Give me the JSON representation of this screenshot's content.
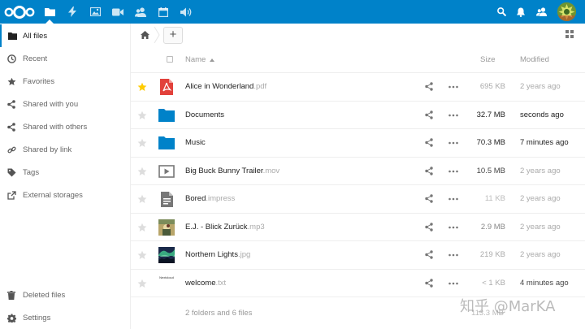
{
  "header": {
    "apps": [
      "Files",
      "Activity",
      "Gallery",
      "Talk",
      "Contacts",
      "Calendar",
      "Audio player"
    ],
    "icons": [
      "nextcloud-logo",
      "folder-icon",
      "bolt-icon",
      "image-icon",
      "video-icon",
      "contacts-icon",
      "calendar-icon",
      "speaker-icon",
      "search-icon",
      "notifications-icon",
      "contacts-menu-icon",
      "avatar"
    ]
  },
  "sidebar": {
    "items": [
      {
        "label": "All files",
        "icon": "folder-icon"
      },
      {
        "label": "Recent",
        "icon": "clock-icon"
      },
      {
        "label": "Favorites",
        "icon": "star-icon"
      },
      {
        "label": "Shared with you",
        "icon": "share-icon"
      },
      {
        "label": "Shared with others",
        "icon": "share-icon"
      },
      {
        "label": "Shared by link",
        "icon": "link-icon"
      },
      {
        "label": "Tags",
        "icon": "tag-icon"
      },
      {
        "label": "External storages",
        "icon": "external-icon"
      }
    ],
    "bottom": [
      {
        "label": "Deleted files",
        "icon": "trash-icon"
      },
      {
        "label": "Settings",
        "icon": "gear-icon"
      }
    ]
  },
  "controls": {
    "new_label": "+"
  },
  "table": {
    "columns": {
      "name": "Name",
      "size": "Size",
      "modified": "Modified"
    },
    "rows": [
      {
        "name": "Alice in Wonderland",
        "ext": ".pdf",
        "size": "695 KB",
        "modified": "2 years ago",
        "icon": "pdf-icon",
        "favorite": true,
        "size_color": "#aaaaaa",
        "mod_color": "#aaaaaa"
      },
      {
        "name": "Documents",
        "ext": "",
        "size": "32.7 MB",
        "modified": "seconds ago",
        "icon": "folder-icon",
        "favorite": false,
        "size_color": "#222222",
        "mod_color": "#222222"
      },
      {
        "name": "Music",
        "ext": "",
        "size": "70.3 MB",
        "modified": "7 minutes ago",
        "icon": "folder-icon",
        "favorite": false,
        "size_color": "#222222",
        "mod_color": "#222222"
      },
      {
        "name": "Big Buck Bunny Trailer",
        "ext": ".mov",
        "size": "10.5 MB",
        "modified": "2 years ago",
        "icon": "video-file-icon",
        "favorite": false,
        "size_color": "#444444",
        "mod_color": "#aaaaaa"
      },
      {
        "name": "Bored",
        "ext": ".impress",
        "size": "11 KB",
        "modified": "2 years ago",
        "icon": "document-icon",
        "favorite": false,
        "size_color": "#bbbbbb",
        "mod_color": "#aaaaaa"
      },
      {
        "name": "E.J. - Blick Zurück",
        "ext": ".mp3",
        "size": "2.9 MB",
        "modified": "2 years ago",
        "icon": "album-art-thumbnail",
        "favorite": false,
        "size_color": "#888888",
        "mod_color": "#aaaaaa"
      },
      {
        "name": "Northern Lights",
        "ext": ".jpg",
        "size": "219 KB",
        "modified": "2 years ago",
        "icon": "image-thumbnail",
        "favorite": false,
        "size_color": "#aaaaaa",
        "mod_color": "#aaaaaa"
      },
      {
        "name": "welcome",
        "ext": ".txt",
        "size": "< 1 KB",
        "modified": "4 minutes ago",
        "icon": "text-file-thumbnail",
        "thumb_text": "Nextcloud",
        "favorite": false,
        "size_color": "#aaaaaa",
        "mod_color": "#444444"
      }
    ],
    "summary": "2 folders and 6 files",
    "summary_size": "113.3 MB"
  },
  "watermark": "知乎 @MarKA",
  "colors": {
    "brand": "#0082c9",
    "favorite": "#fc0",
    "pdf": "#e2413b",
    "folder": "#0082c9"
  }
}
